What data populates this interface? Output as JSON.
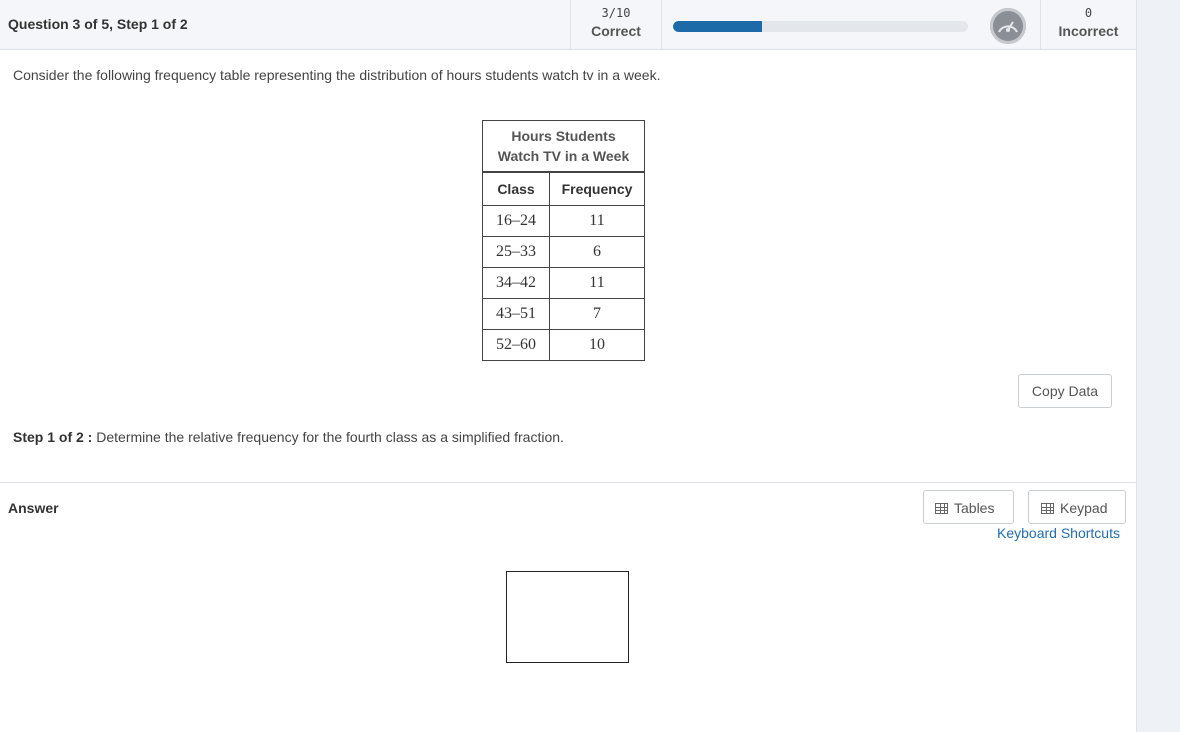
{
  "header": {
    "question_progress": "Question 3 of 5,  Step 1 of 2",
    "correct_count": "3/10",
    "correct_label": "Correct",
    "progress_fraction": 0.3,
    "incorrect_count": "0",
    "incorrect_label": "Incorrect"
  },
  "question": {
    "text": "Consider the following frequency table representing the distribution of hours students watch tv in a week."
  },
  "table": {
    "caption_line1": "Hours Students",
    "caption_line2": "Watch TV in a Week",
    "col_class": "Class",
    "col_frequency": "Frequency",
    "rows": [
      {
        "class": "16–24",
        "frequency": "11"
      },
      {
        "class": "25–33",
        "frequency": "6"
      },
      {
        "class": "34–42",
        "frequency": "11"
      },
      {
        "class": "43–51",
        "frequency": "7"
      },
      {
        "class": "52–60",
        "frequency": "10"
      }
    ]
  },
  "copy_button": "Copy Data",
  "step": {
    "label": "Step 1 of 2 :",
    "instruction": "Determine the relative frequency for the fourth class as a simplified fraction."
  },
  "answer": {
    "label": "Answer",
    "tables_button": "Tables",
    "keypad_button": "Keypad",
    "shortcuts_link": "Keyboard Shortcuts"
  },
  "colors": {
    "progress_fill": "#1c6aa8",
    "link": "#1f6db3"
  },
  "icons": {
    "gauge": "gauge-icon",
    "tables": "table-grid-icon",
    "keypad": "keypad-icon"
  }
}
